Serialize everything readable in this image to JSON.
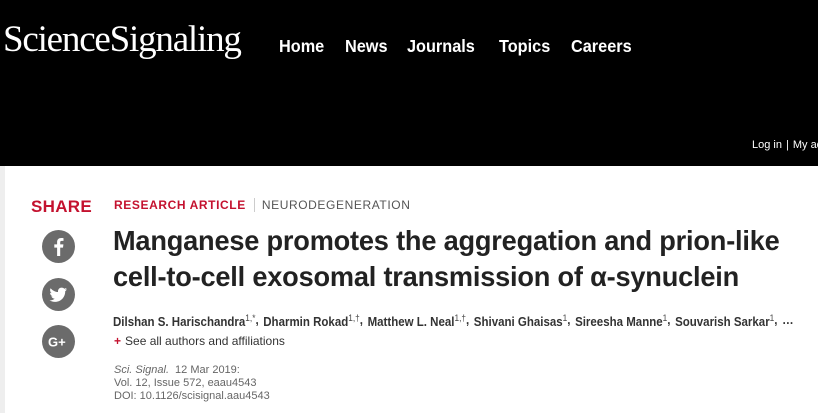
{
  "header": {
    "logo": "ScienceSignaling",
    "nav": [
      "Home",
      "News",
      "Journals",
      "Topics",
      "Careers"
    ],
    "user_links": {
      "login": "Log in",
      "separator": "|",
      "account": "My ac"
    }
  },
  "share": {
    "label": "SHARE",
    "buttons": [
      {
        "name": "facebook",
        "icon": "facebook-icon"
      },
      {
        "name": "twitter",
        "icon": "twitter-icon"
      },
      {
        "name": "google-plus",
        "icon": "google-plus-icon"
      }
    ]
  },
  "article": {
    "type": "RESEARCH ARTICLE",
    "subject": "NEURODEGENERATION",
    "title_lines": [
      "Manganese promotes the aggregation and prion-like",
      "cell-to-cell exosomal transmission of α-synuclein"
    ],
    "authors": [
      {
        "name": "Dilshan S. Harischandra",
        "sup": "1,*"
      },
      {
        "name": "Dharmin Rokad",
        "sup": "1,†"
      },
      {
        "name": "Matthew L. Neal",
        "sup": "1,†"
      },
      {
        "name": "Shivani Ghaisas",
        "sup": "1"
      },
      {
        "name": "Sireesha Manne",
        "sup": "1"
      },
      {
        "name": "Souvarish Sarkar",
        "sup": "1"
      }
    ],
    "authors_more": "…",
    "see_all": "See all authors and affiliations",
    "citation": {
      "journal": "Sci. Signal.",
      "date": "12 Mar 2019:",
      "volume": "Vol. 12, Issue 572, eaau4543",
      "doi": "DOI: 10.1126/scisignal.aau4543"
    }
  },
  "colors": {
    "header_bg": "#000000",
    "accent": "#c4122f",
    "share_icon_bg": "#6b6b6b"
  }
}
